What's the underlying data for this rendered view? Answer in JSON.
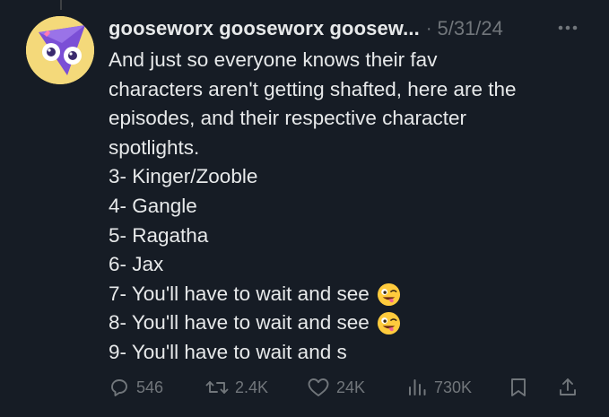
{
  "post": {
    "author_name": "gooseworx gooseworx goosew...",
    "separator": "·",
    "date": "5/31/24",
    "lines": [
      "And just so everyone knows their fav",
      "characters aren't getting shafted, here are the",
      "episodes, and their respective character",
      "spotlights.",
      "3- Kinger/Zooble",
      "4- Gangle",
      "5- Ragatha",
      "6- Jax",
      "7- You'll have to wait and see",
      "8- You'll have to wait and see",
      "9- You'll have to wait and s"
    ],
    "emoji_lines": [
      8,
      9
    ],
    "emoji_name": "zany-face-emoji"
  },
  "actions": {
    "replies": "546",
    "reposts": "2.4K",
    "likes": "24K",
    "views": "730K"
  },
  "colors": {
    "background": "#161c25",
    "text": "#e7e9ea",
    "muted": "#71767b",
    "avatar_bg": "#f4d97a",
    "avatar_accent": "#7b4fd6"
  },
  "icons": [
    "more-icon",
    "reply-icon",
    "repost-icon",
    "like-icon",
    "views-icon",
    "bookmark-icon",
    "share-icon"
  ]
}
